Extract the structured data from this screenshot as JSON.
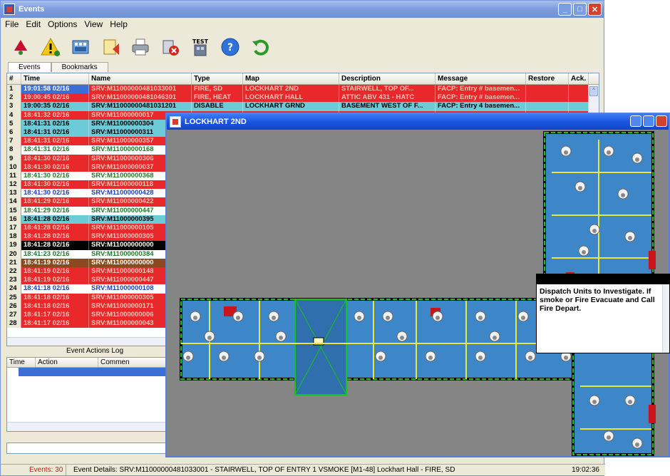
{
  "window": {
    "title": "Events"
  },
  "menu": [
    "File",
    "Edit",
    "Options",
    "View",
    "Help"
  ],
  "toolbar": {
    "test_label": "TEST"
  },
  "tabs": [
    "Events",
    "Bookmarks"
  ],
  "columns": [
    "#",
    "Time",
    "Name",
    "Type",
    "Map",
    "Description",
    "Message",
    "Restore",
    "Ack."
  ],
  "rows": [
    {
      "num": "1",
      "time": "19:01:58 02/16",
      "name": "SRV:M11000000481033001",
      "type": "FIRE, SD",
      "map": "LOCKHART 2ND",
      "desc": "STAIRWELL, TOP OF...",
      "msg": "FACP: Entry # basemen...",
      "style": "red",
      "sel": true
    },
    {
      "num": "2",
      "time": "19:00:45 02/16",
      "name": "SRV:M11000000481046301",
      "type": "FIRE, HEAT",
      "map": "LOCKHART HALL",
      "desc": "ATTIC ABV 431 - HATC",
      "msg": "FACP: Entry # basemen...",
      "style": "red"
    },
    {
      "num": "3",
      "time": "19:00:35 02/16",
      "name": "SRV:M11000000481031201",
      "type": "DISABLE",
      "map": "LOCKHART GRND",
      "desc": "BASEMENT WEST OF F...",
      "msg": "FACP: Entry 4 basemen...",
      "style": "cyan"
    },
    {
      "num": "4",
      "time": "18:41:32 02/16",
      "name": "SRV:M11000000017",
      "style": "red"
    },
    {
      "num": "5",
      "time": "18:41:31 02/16",
      "name": "SRV:M11000000304",
      "style": "cyan"
    },
    {
      "num": "6",
      "time": "18:41:31 02/16",
      "name": "SRV:M11000000311",
      "style": "cyan"
    },
    {
      "num": "7",
      "time": "18:41:31 02/16",
      "name": "SRV:M11000000357",
      "style": "red"
    },
    {
      "num": "8",
      "time": "18:41:31 02/16",
      "name": "SRV:M11000000168",
      "style": "white-green"
    },
    {
      "num": "9",
      "time": "18:41:30 02/16",
      "name": "SRV:M11000000306",
      "style": "red"
    },
    {
      "num": "10",
      "time": "18:41:30 02/16",
      "name": "SRV:M11000000037",
      "style": "red"
    },
    {
      "num": "11",
      "time": "18:41:30 02/16",
      "name": "SRV:M11000000368",
      "style": "white-green"
    },
    {
      "num": "12",
      "time": "18:41:30 02/16",
      "name": "SRV:M11000000118",
      "style": "red"
    },
    {
      "num": "13",
      "time": "18:41:30 02/16",
      "name": "SRV:M11000000428",
      "style": "white-blue"
    },
    {
      "num": "14",
      "time": "18:41:29 02/16",
      "name": "SRV:M11000000422",
      "style": "red"
    },
    {
      "num": "15",
      "time": "18:41:29 02/16",
      "name": "SRV:M11000000447",
      "style": "white-green"
    },
    {
      "num": "16",
      "time": "18:41:28 02/16",
      "name": "SRV:M11000000395",
      "style": "cyan"
    },
    {
      "num": "17",
      "time": "18:41:28 02/16",
      "name": "SRV:M11000000105",
      "style": "red"
    },
    {
      "num": "18",
      "time": "18:41:28 02/16",
      "name": "SRV:M11000000305",
      "style": "red"
    },
    {
      "num": "19",
      "time": "18:41:28 02/16",
      "name": "SRV:M11000000000",
      "style": "black"
    },
    {
      "num": "20",
      "time": "18:41:23 02/16",
      "name": "SRV:M11000000384",
      "style": "white-green"
    },
    {
      "num": "21",
      "time": "18:41:19 02/16",
      "name": "SRV:M11000000000",
      "style": "brown"
    },
    {
      "num": "22",
      "time": "18:41:19 02/16",
      "name": "SRV:M11000000148",
      "style": "red"
    },
    {
      "num": "23",
      "time": "18:41:19 02/16",
      "name": "SRV:M11000000447",
      "style": "red"
    },
    {
      "num": "24",
      "time": "18:41:18 02/16",
      "name": "SRV:M11000000108",
      "style": "white-blue"
    },
    {
      "num": "25",
      "time": "18:41:18 02/16",
      "name": "SRV:M11000000305",
      "style": "red"
    },
    {
      "num": "26",
      "time": "18:41:18 02/16",
      "name": "SRV:M11000000171",
      "style": "red"
    },
    {
      "num": "27",
      "time": "18:41:17 02/16",
      "name": "SRV:M11000000006",
      "style": "red"
    },
    {
      "num": "28",
      "time": "18:41:17 02/16",
      "name": "SRV:M11000000043",
      "style": "red"
    }
  ],
  "row_styles": {
    "red": {
      "bg": "#e8282a",
      "fg": "#f7c3b5"
    },
    "cyan": {
      "bg": "#6ccbd6",
      "fg": "#000000"
    },
    "white-green": {
      "bg": "#ffffff",
      "fg": "#1f7a2a"
    },
    "white-blue": {
      "bg": "#ffffff",
      "fg": "#1a3fbf"
    },
    "black": {
      "bg": "#000000",
      "fg": "#ffffff"
    },
    "brown": {
      "bg": "#8a4a1e",
      "fg": "#ffffff"
    },
    "selected": {
      "bg": "#3b6fd8",
      "fg": "#ffffff"
    }
  },
  "log": {
    "title": "Event Actions Log",
    "columns": [
      "Time",
      "Action",
      "Commen"
    ]
  },
  "status": {
    "count": "Events: 30",
    "details": "Event Details: SRV:M11000000481033001 - STAIRWELL, TOP OF ENTRY 1 VSMOKE [M1-48] Lockhart Hall - FIRE, SD",
    "time": "19:02:36"
  },
  "map_window": {
    "title": "LOCKHART 2ND"
  },
  "popup": {
    "text": "Dispatch Units to Investigate.  If smoke or Fire Evacuate and Call Fire Depart."
  },
  "colors": {
    "floor_fill": "#3d86c8",
    "wall": "#0a0a0a",
    "outline": "#19c219",
    "corridor": "#e8e83a"
  }
}
